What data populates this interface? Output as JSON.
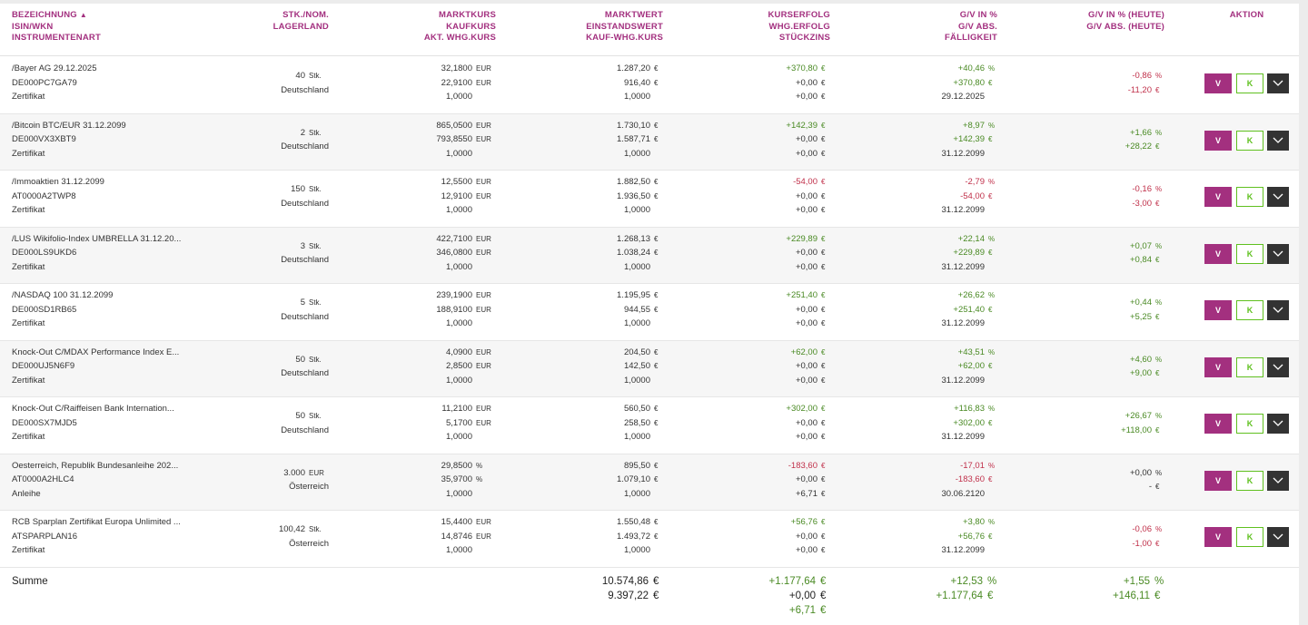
{
  "header": {
    "col1": [
      "BEZEICHNUNG",
      "ISIN/WKN",
      "INSTRUMENTENART"
    ],
    "sort_indicator": "▲",
    "col2": [
      "STK./NOM.",
      "LAGERLAND"
    ],
    "col3": [
      "MARKTKURS",
      "KAUFKURS",
      "AKT. WHG.KURS"
    ],
    "col4": [
      "MARKTWERT",
      "EINSTANDSWERT",
      "KAUF-WHG.KURS"
    ],
    "col5": [
      "KURSERFOLG",
      "WHG.ERFOLG",
      "STÜCKZINS"
    ],
    "col6": [
      "G/V IN %",
      "G/V ABS.",
      "FÄLLIGKEIT"
    ],
    "col7": [
      "G/V IN % (HEUTE)",
      "G/V ABS. (HEUTE)"
    ],
    "col8": [
      "AKTION"
    ]
  },
  "buttons": {
    "v": "V",
    "k": "K",
    "more": "chevron-down-icon"
  },
  "colors": {
    "accent": "#a3307f",
    "positive": "#4a8a24",
    "negative": "#c0304a",
    "buy": "#5fc01f"
  },
  "rows": [
    {
      "name": "/Bayer AG 29.12.2025",
      "isin": "DE000PC7GA79",
      "type": "Zertifikat",
      "qty": "40",
      "qty_unit": "Stk.",
      "land": "Deutschland",
      "kurs": [
        [
          "32,1800",
          "EUR"
        ],
        [
          "22,9100",
          "EUR"
        ],
        [
          "1,0000",
          ""
        ]
      ],
      "mw": [
        [
          "1.287,20",
          "€"
        ],
        [
          "916,40",
          "€"
        ],
        [
          "1,0000",
          ""
        ]
      ],
      "kerf": [
        [
          "+370,80",
          "€"
        ],
        [
          "+0,00",
          "€"
        ],
        [
          "+0,00",
          "€"
        ]
      ],
      "kerf_first_sign": "pos",
      "gv": [
        [
          "+40,46",
          "%"
        ],
        [
          "+370,80",
          "€"
        ],
        [
          "29.12.2025",
          ""
        ]
      ],
      "gv_sign": "pos",
      "heute": [
        [
          "-0,86",
          "%"
        ],
        [
          "-11,20",
          "€"
        ]
      ],
      "heute_sign": "neg"
    },
    {
      "name": "/Bitcoin BTC/EUR 31.12.2099",
      "isin": "DE000VX3XBT9",
      "type": "Zertifikat",
      "qty": "2",
      "qty_unit": "Stk.",
      "land": "Deutschland",
      "kurs": [
        [
          "865,0500",
          "EUR"
        ],
        [
          "793,8550",
          "EUR"
        ],
        [
          "1,0000",
          ""
        ]
      ],
      "mw": [
        [
          "1.730,10",
          "€"
        ],
        [
          "1.587,71",
          "€"
        ],
        [
          "1,0000",
          ""
        ]
      ],
      "kerf": [
        [
          "+142,39",
          "€"
        ],
        [
          "+0,00",
          "€"
        ],
        [
          "+0,00",
          "€"
        ]
      ],
      "kerf_first_sign": "pos",
      "gv": [
        [
          "+8,97",
          "%"
        ],
        [
          "+142,39",
          "€"
        ],
        [
          "31.12.2099",
          ""
        ]
      ],
      "gv_sign": "pos",
      "heute": [
        [
          "+1,66",
          "%"
        ],
        [
          "+28,22",
          "€"
        ]
      ],
      "heute_sign": "pos"
    },
    {
      "name": "/Immoaktien 31.12.2099",
      "isin": "AT0000A2TWP8",
      "type": "Zertifikat",
      "qty": "150",
      "qty_unit": "Stk.",
      "land": "Deutschland",
      "kurs": [
        [
          "12,5500",
          "EUR"
        ],
        [
          "12,9100",
          "EUR"
        ],
        [
          "1,0000",
          ""
        ]
      ],
      "mw": [
        [
          "1.882,50",
          "€"
        ],
        [
          "1.936,50",
          "€"
        ],
        [
          "1,0000",
          ""
        ]
      ],
      "kerf": [
        [
          "-54,00",
          "€"
        ],
        [
          "+0,00",
          "€"
        ],
        [
          "+0,00",
          "€"
        ]
      ],
      "kerf_first_sign": "neg",
      "gv": [
        [
          "-2,79",
          "%"
        ],
        [
          "-54,00",
          "€"
        ],
        [
          "31.12.2099",
          ""
        ]
      ],
      "gv_sign": "neg",
      "heute": [
        [
          "-0,16",
          "%"
        ],
        [
          "-3,00",
          "€"
        ]
      ],
      "heute_sign": "neg"
    },
    {
      "name": "/LUS Wikifolio-Index UMBRELLA 31.12.20...",
      "isin": "DE000LS9UKD6",
      "type": "Zertifikat",
      "qty": "3",
      "qty_unit": "Stk.",
      "land": "Deutschland",
      "kurs": [
        [
          "422,7100",
          "EUR"
        ],
        [
          "346,0800",
          "EUR"
        ],
        [
          "1,0000",
          ""
        ]
      ],
      "mw": [
        [
          "1.268,13",
          "€"
        ],
        [
          "1.038,24",
          "€"
        ],
        [
          "1,0000",
          ""
        ]
      ],
      "kerf": [
        [
          "+229,89",
          "€"
        ],
        [
          "+0,00",
          "€"
        ],
        [
          "+0,00",
          "€"
        ]
      ],
      "kerf_first_sign": "pos",
      "gv": [
        [
          "+22,14",
          "%"
        ],
        [
          "+229,89",
          "€"
        ],
        [
          "31.12.2099",
          ""
        ]
      ],
      "gv_sign": "pos",
      "heute": [
        [
          "+0,07",
          "%"
        ],
        [
          "+0,84",
          "€"
        ]
      ],
      "heute_sign": "pos"
    },
    {
      "name": "/NASDAQ 100 31.12.2099",
      "isin": "DE000SD1RB65",
      "type": "Zertifikat",
      "qty": "5",
      "qty_unit": "Stk.",
      "land": "Deutschland",
      "kurs": [
        [
          "239,1900",
          "EUR"
        ],
        [
          "188,9100",
          "EUR"
        ],
        [
          "1,0000",
          ""
        ]
      ],
      "mw": [
        [
          "1.195,95",
          "€"
        ],
        [
          "944,55",
          "€"
        ],
        [
          "1,0000",
          ""
        ]
      ],
      "kerf": [
        [
          "+251,40",
          "€"
        ],
        [
          "+0,00",
          "€"
        ],
        [
          "+0,00",
          "€"
        ]
      ],
      "kerf_first_sign": "pos",
      "gv": [
        [
          "+26,62",
          "%"
        ],
        [
          "+251,40",
          "€"
        ],
        [
          "31.12.2099",
          ""
        ]
      ],
      "gv_sign": "pos",
      "heute": [
        [
          "+0,44",
          "%"
        ],
        [
          "+5,25",
          "€"
        ]
      ],
      "heute_sign": "pos"
    },
    {
      "name": "Knock-Out C/MDAX Performance Index E...",
      "isin": "DE000UJ5N6F9",
      "type": "Zertifikat",
      "qty": "50",
      "qty_unit": "Stk.",
      "land": "Deutschland",
      "kurs": [
        [
          "4,0900",
          "EUR"
        ],
        [
          "2,8500",
          "EUR"
        ],
        [
          "1,0000",
          ""
        ]
      ],
      "mw": [
        [
          "204,50",
          "€"
        ],
        [
          "142,50",
          "€"
        ],
        [
          "1,0000",
          ""
        ]
      ],
      "kerf": [
        [
          "+62,00",
          "€"
        ],
        [
          "+0,00",
          "€"
        ],
        [
          "+0,00",
          "€"
        ]
      ],
      "kerf_first_sign": "pos",
      "gv": [
        [
          "+43,51",
          "%"
        ],
        [
          "+62,00",
          "€"
        ],
        [
          "31.12.2099",
          ""
        ]
      ],
      "gv_sign": "pos",
      "heute": [
        [
          "+4,60",
          "%"
        ],
        [
          "+9,00",
          "€"
        ]
      ],
      "heute_sign": "pos"
    },
    {
      "name": "Knock-Out C/Raiffeisen Bank Internation...",
      "isin": "DE000SX7MJD5",
      "type": "Zertifikat",
      "qty": "50",
      "qty_unit": "Stk.",
      "land": "Deutschland",
      "kurs": [
        [
          "11,2100",
          "EUR"
        ],
        [
          "5,1700",
          "EUR"
        ],
        [
          "1,0000",
          ""
        ]
      ],
      "mw": [
        [
          "560,50",
          "€"
        ],
        [
          "258,50",
          "€"
        ],
        [
          "1,0000",
          ""
        ]
      ],
      "kerf": [
        [
          "+302,00",
          "€"
        ],
        [
          "+0,00",
          "€"
        ],
        [
          "+0,00",
          "€"
        ]
      ],
      "kerf_first_sign": "pos",
      "gv": [
        [
          "+116,83",
          "%"
        ],
        [
          "+302,00",
          "€"
        ],
        [
          "31.12.2099",
          ""
        ]
      ],
      "gv_sign": "pos",
      "heute": [
        [
          "+26,67",
          "%"
        ],
        [
          "+118,00",
          "€"
        ]
      ],
      "heute_sign": "pos"
    },
    {
      "name": "Oesterreich, Republik Bundesanleihe 202...",
      "isin": "AT0000A2HLC4",
      "type": "Anleihe",
      "qty": "3.000",
      "qty_unit": "EUR",
      "land": "Österreich",
      "kurs": [
        [
          "29,8500",
          "%"
        ],
        [
          "35,9700",
          "%"
        ],
        [
          "1,0000",
          ""
        ]
      ],
      "mw": [
        [
          "895,50",
          "€"
        ],
        [
          "1.079,10",
          "€"
        ],
        [
          "1,0000",
          ""
        ]
      ],
      "kerf": [
        [
          "-183,60",
          "€"
        ],
        [
          "+0,00",
          "€"
        ],
        [
          "+6,71",
          "€"
        ]
      ],
      "kerf_first_sign": "neg",
      "gv": [
        [
          "-17,01",
          "%"
        ],
        [
          "-183,60",
          "€"
        ],
        [
          "30.06.2120",
          ""
        ]
      ],
      "gv_sign": "neg",
      "heute": [
        [
          "+0,00",
          "%"
        ],
        [
          "-",
          "€"
        ]
      ],
      "heute_sign": "zero"
    },
    {
      "name": "RCB Sparplan Zertifikat Europa Unlimited ...",
      "isin": "ATSPARPLAN16",
      "type": "Zertifikat",
      "qty": "100,42",
      "qty_unit": "Stk.",
      "land": "Österreich",
      "kurs": [
        [
          "15,4400",
          "EUR"
        ],
        [
          "14,8746",
          "EUR"
        ],
        [
          "1,0000",
          ""
        ]
      ],
      "mw": [
        [
          "1.550,48",
          "€"
        ],
        [
          "1.493,72",
          "€"
        ],
        [
          "1,0000",
          ""
        ]
      ],
      "kerf": [
        [
          "+56,76",
          "€"
        ],
        [
          "+0,00",
          "€"
        ],
        [
          "+0,00",
          "€"
        ]
      ],
      "kerf_first_sign": "pos",
      "gv": [
        [
          "+3,80",
          "%"
        ],
        [
          "+56,76",
          "€"
        ],
        [
          "31.12.2099",
          ""
        ]
      ],
      "gv_sign": "pos",
      "heute": [
        [
          "-0,06",
          "%"
        ],
        [
          "-1,00",
          "€"
        ]
      ],
      "heute_sign": "neg"
    }
  ],
  "summe": {
    "label": "Summe",
    "mw": [
      [
        "10.574,86",
        "€"
      ],
      [
        "9.397,22",
        "€"
      ]
    ],
    "kerf": [
      [
        "+1.177,64",
        "€"
      ],
      [
        "+0,00",
        "€"
      ],
      [
        "+6,71",
        "€"
      ]
    ],
    "gv": [
      [
        "+12,53",
        "%"
      ],
      [
        "+1.177,64",
        "€"
      ]
    ],
    "heute": [
      [
        "+1,55",
        "%"
      ],
      [
        "+146,11",
        "€"
      ]
    ]
  }
}
